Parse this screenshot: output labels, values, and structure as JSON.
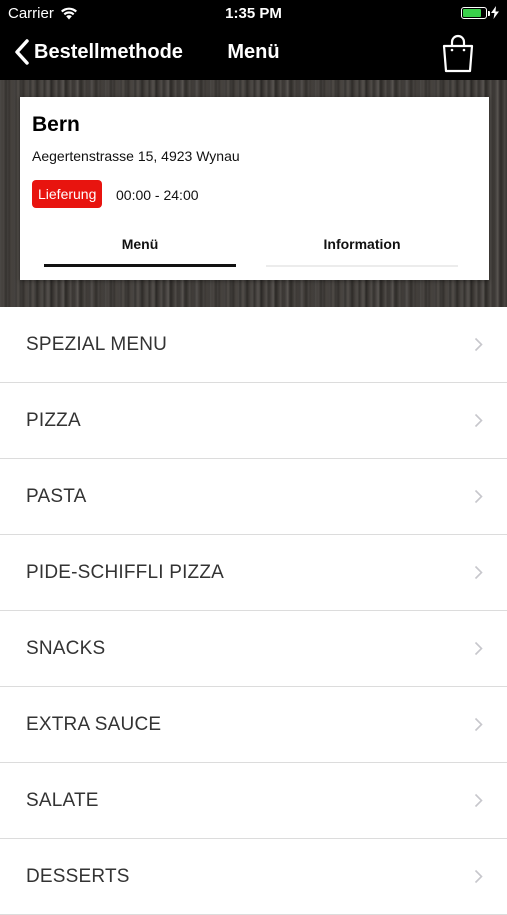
{
  "status_bar": {
    "carrier": "Carrier",
    "time": "1:35 PM",
    "battery_level": 0.75
  },
  "nav": {
    "back_label": "Bestellmethode",
    "title": "Menü",
    "cart_icon": "shopping-bag-icon"
  },
  "store": {
    "name": "Bern",
    "address": "Aegertenstrasse 15, 4923 Wynau",
    "badge": "Lieferung",
    "badge_color": "#e8140f",
    "hours": "00:00 - 24:00"
  },
  "tabs": [
    {
      "label": "Menü",
      "active": true
    },
    {
      "label": "Information",
      "active": false
    }
  ],
  "categories": [
    {
      "label": "SPEZIAL MENU"
    },
    {
      "label": "PIZZA"
    },
    {
      "label": "PASTA"
    },
    {
      "label": "PIDE-SCHIFFLI PIZZA"
    },
    {
      "label": "SNACKS"
    },
    {
      "label": "EXTRA SAUCE"
    },
    {
      "label": "SALATE"
    },
    {
      "label": "DESSERTS"
    }
  ]
}
